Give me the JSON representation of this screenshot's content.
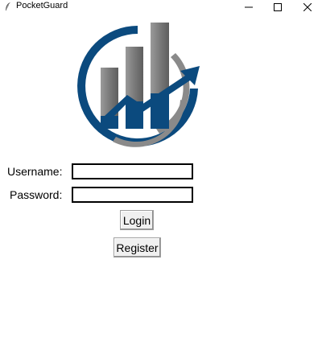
{
  "window": {
    "title": "PocketGuard",
    "controls": {
      "minimize": "minimize-icon",
      "maximize": "maximize-icon",
      "close": "close-icon"
    }
  },
  "logo": {
    "icon": "bar-chart-growth-icon",
    "colors": {
      "navy": "#0b4a7e",
      "gray": "#7a7a7a"
    }
  },
  "form": {
    "username_label": "Username:",
    "username_value": "",
    "password_label": "Password:",
    "password_value": ""
  },
  "buttons": {
    "login_label": "Login",
    "register_label": "Register"
  }
}
